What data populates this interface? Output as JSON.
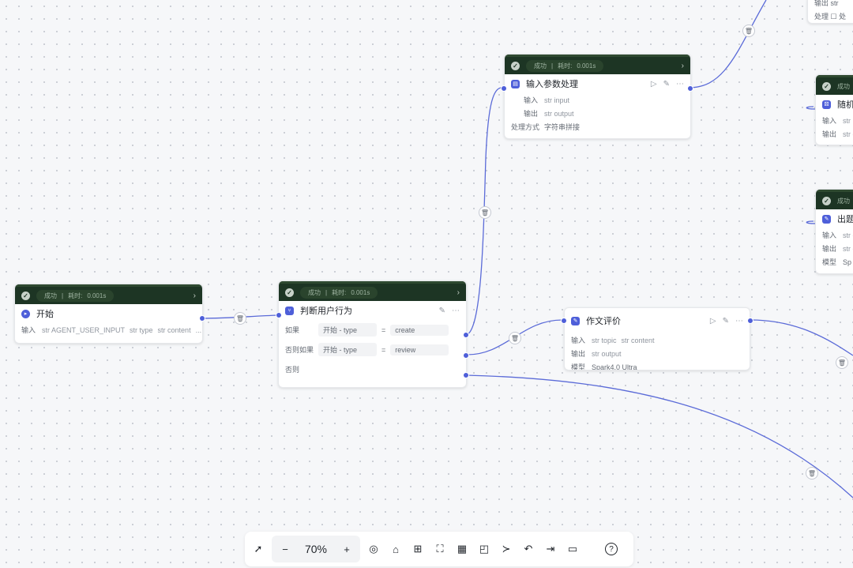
{
  "status": {
    "success": "成功",
    "sep": "|",
    "time_label": "耗时:",
    "time": "0.001s"
  },
  "nodes": {
    "start": {
      "title": "开始",
      "input_label": "输入",
      "params": [
        "str AGENT_USER_INPUT",
        "str type",
        "str content"
      ],
      "more": "..."
    },
    "judge": {
      "title": "判断用户行为",
      "rows": [
        {
          "label": "如果",
          "left": "开始 - type",
          "op": "=",
          "right": "create"
        },
        {
          "label": "否则如果",
          "left": "开始 - type",
          "op": "=",
          "right": "review"
        },
        {
          "label": "否则",
          "left": "",
          "op": "",
          "right": ""
        }
      ]
    },
    "input_proc": {
      "title": "输入参数处理",
      "input_label": "输入",
      "input": "str input",
      "output_label": "输出",
      "output": "str output",
      "mode_label": "处理方式",
      "mode": "字符串拼接"
    },
    "essay": {
      "title": "作文评价",
      "input_label": "输入",
      "inputs": [
        "str topic",
        "str content"
      ],
      "output_label": "输出",
      "output": "str output",
      "model_label": "模型",
      "model": "Spark4.0 Ultra"
    },
    "right1": {
      "title": "随机",
      "input_label": "输入",
      "input": "str in",
      "output_label": "输出",
      "output": "str ou"
    },
    "right2": {
      "title": "出题",
      "input_label": "输入",
      "input": "str c",
      "output_label": "输出",
      "output": "str o",
      "model_label": "模型",
      "model": "Sp"
    },
    "top_partial": {
      "line1": "输出 str",
      "line2": "处理 ☐ 处"
    }
  },
  "toolbar": {
    "zoom": "70%",
    "minus": "−",
    "plus": "+"
  },
  "colors": {
    "accent": "#4e5fd9",
    "status_bg": "#1d3524"
  }
}
